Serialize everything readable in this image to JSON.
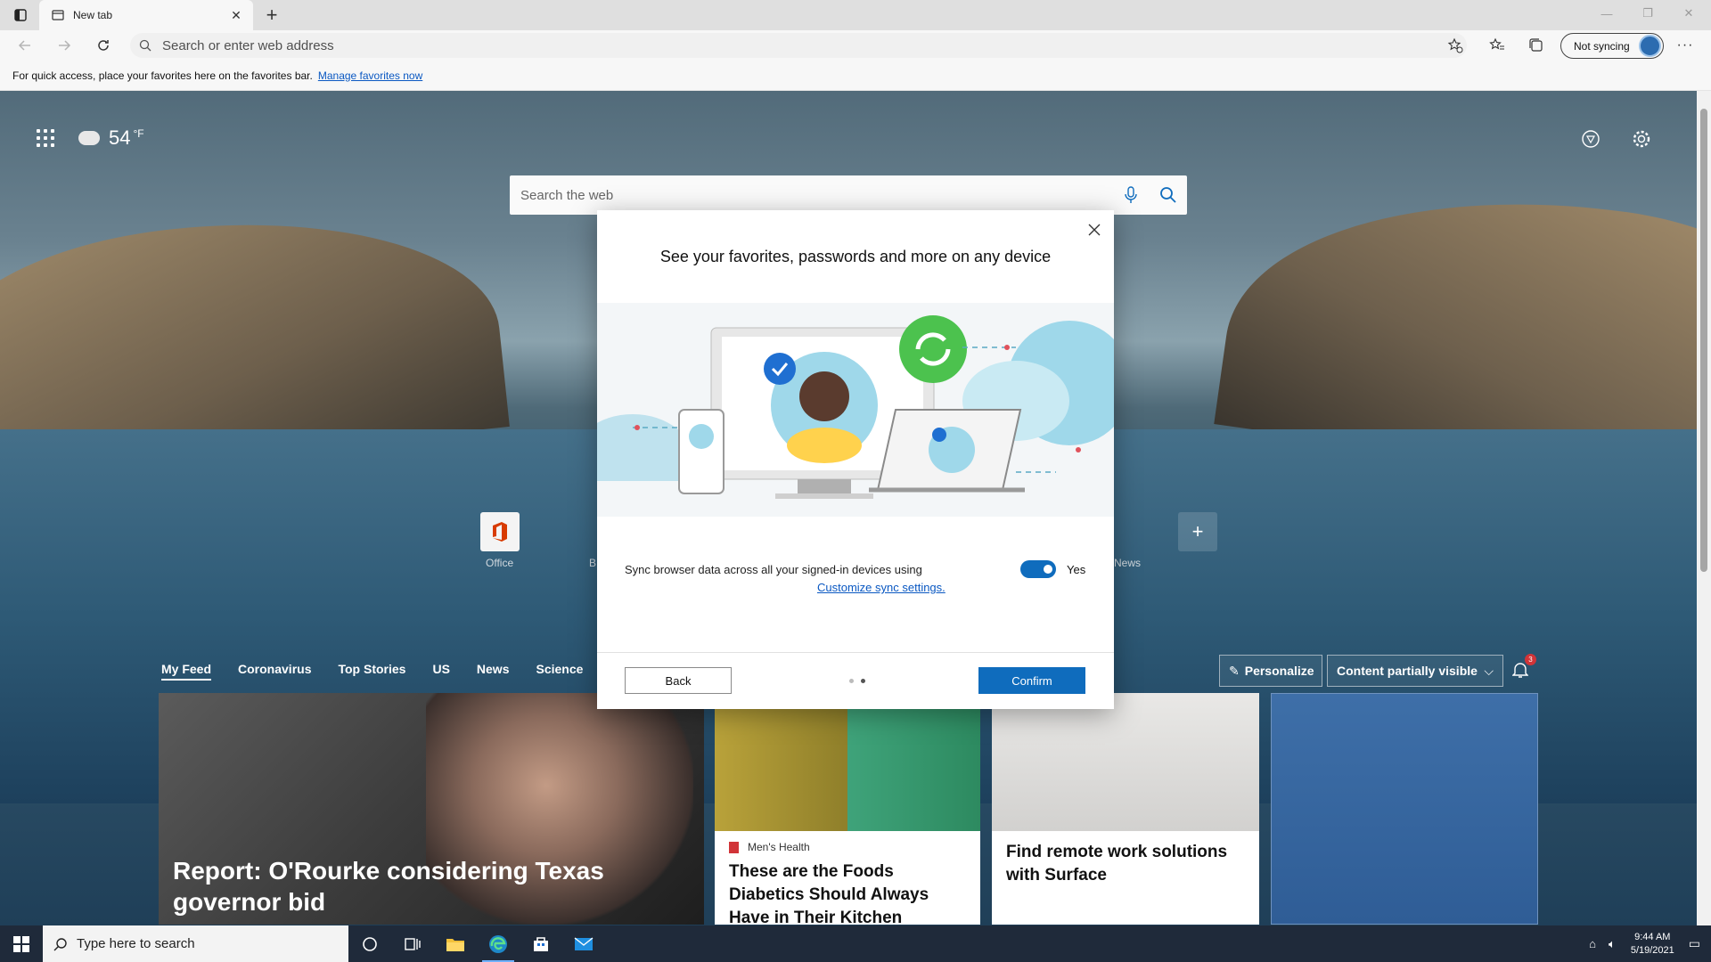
{
  "browser": {
    "tab_title": "New tab",
    "address_placeholder": "Search or enter web address",
    "sync_label": "Not syncing",
    "favbar_text": "For quick access, place your favorites here on the favorites bar.",
    "favbar_link": "Manage favorites now"
  },
  "newtab": {
    "weather_temp": "54",
    "weather_unit": "°F",
    "search_placeholder": "Search the web",
    "quicklinks": [
      {
        "label": "Office"
      },
      {
        "label": "B"
      },
      {
        "label": "News"
      }
    ],
    "feed_tabs": [
      "My Feed",
      "Coronavirus",
      "Top Stories",
      "US",
      "News",
      "Science"
    ],
    "personalize_label": "Personalize",
    "content_visibility_label": "Content partially visible",
    "notification_count": "3",
    "cards": {
      "big_headline": "Report: O'Rourke considering Texas governor bid",
      "food_source": "Men's Health",
      "food_title": "These are the Foods Diabetics Should Always Have in Their Kitchen",
      "surface_title": "Find remote work solutions with Surface"
    }
  },
  "modal": {
    "title": "See your favorites, passwords and more on any device",
    "sync_text": "Sync browser data across all your signed-in devices using",
    "sync_link": "Customize sync settings.",
    "toggle_label": "Yes",
    "toggle_on": true,
    "back_label": "Back",
    "confirm_label": "Confirm",
    "step_current": 2,
    "step_total": 2
  },
  "taskbar": {
    "search_placeholder": "Type here to search",
    "time": "9:44 AM",
    "date": "5/19/2021"
  },
  "colors": {
    "accent": "#0f6cbd",
    "link": "#0a58c2",
    "taskbar": "#1f2a3a"
  }
}
